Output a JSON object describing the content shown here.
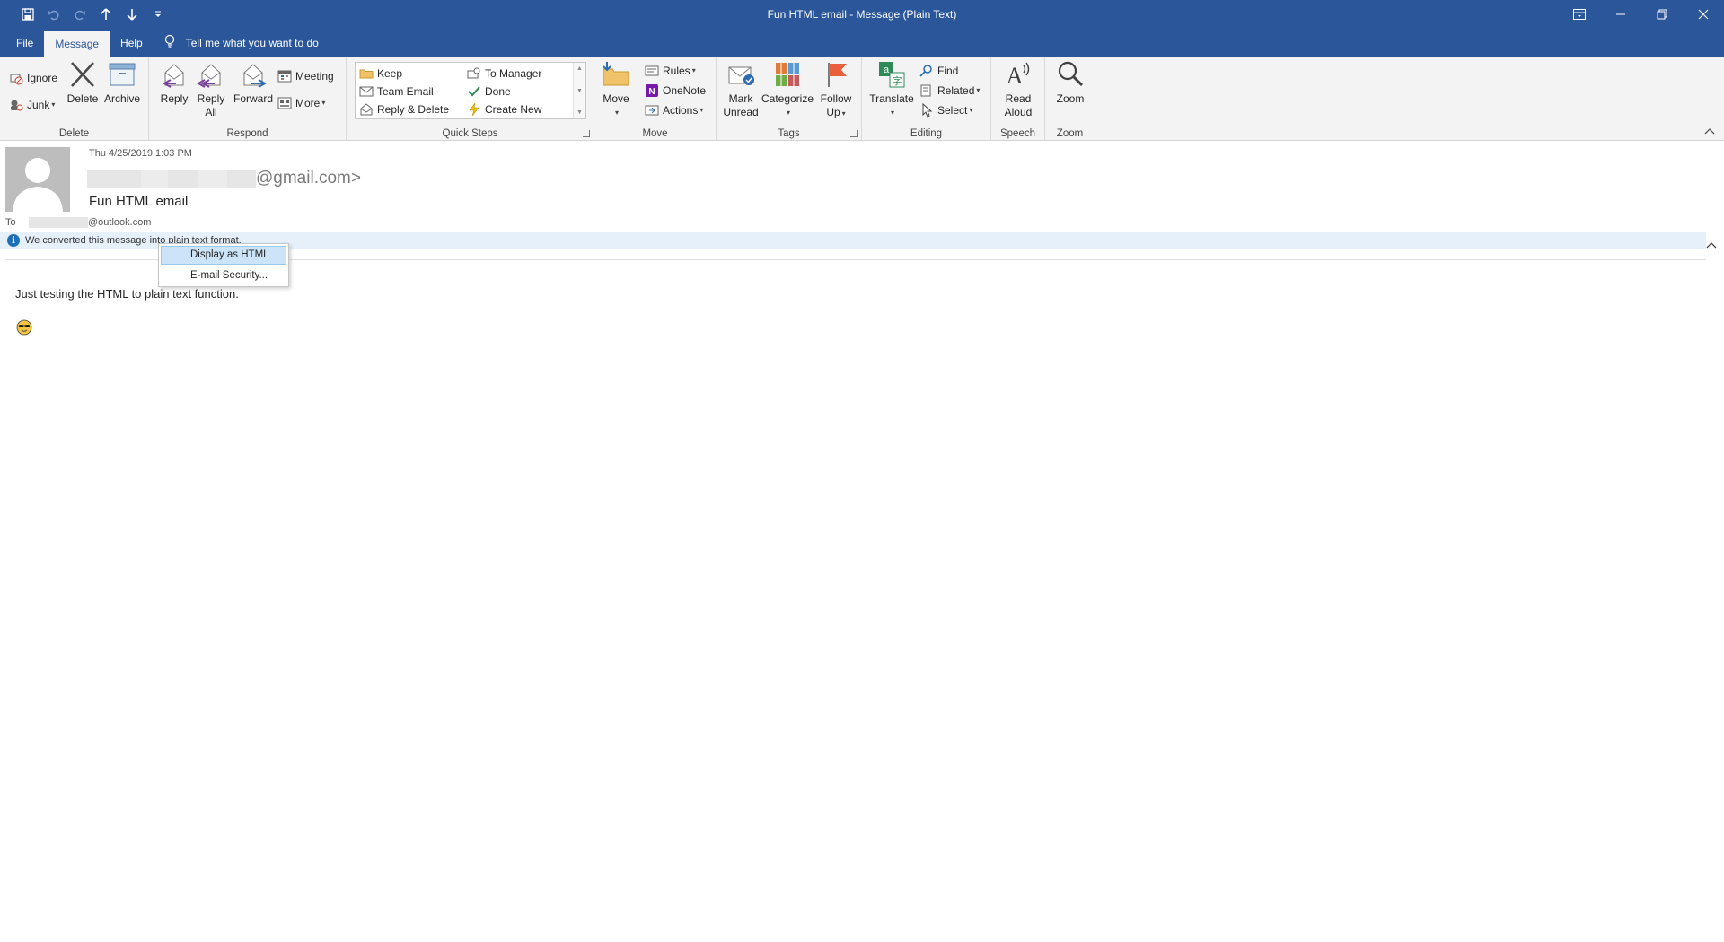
{
  "window": {
    "title": "Fun HTML email  -  Message (Plain Text)"
  },
  "quick_access": {
    "items": [
      "save-icon",
      "undo-icon",
      "redo-icon",
      "previous-item-icon",
      "next-item-icon",
      "customize-icon"
    ]
  },
  "tabs": [
    {
      "label": "File"
    },
    {
      "label": "Message",
      "active": true
    },
    {
      "label": "Help"
    }
  ],
  "tell_me": "Tell me what you want to do",
  "ribbon": {
    "delete_group": {
      "label": "Delete",
      "ignore": "Ignore",
      "junk": "Junk",
      "delete": "Delete",
      "archive": "Archive"
    },
    "respond_group": {
      "label": "Respond",
      "reply": "Reply",
      "reply_all_1": "Reply",
      "reply_all_2": "All",
      "forward": "Forward",
      "meeting": "Meeting",
      "more": "More"
    },
    "quick_steps_group": {
      "label": "Quick Steps",
      "keep": "Keep",
      "team_email": "Team Email",
      "reply_delete": "Reply & Delete",
      "to_manager": "To Manager",
      "done": "Done",
      "create_new": "Create New"
    },
    "move_group": {
      "label": "Move",
      "move": "Move",
      "rules": "Rules",
      "onenote": "OneNote",
      "actions": "Actions"
    },
    "tags_group": {
      "label": "Tags",
      "mark_unread_1": "Mark",
      "mark_unread_2": "Unread",
      "categorize": "Categorize",
      "follow_up_1": "Follow",
      "follow_up_2": "Up"
    },
    "editing_group": {
      "label": "Editing",
      "translate": "Translate",
      "find": "Find",
      "related": "Related",
      "select": "Select"
    },
    "speech_group": {
      "label": "Speech",
      "read_aloud_1": "Read",
      "read_aloud_2": "Aloud"
    },
    "zoom_group": {
      "label": "Zoom",
      "zoom": "Zoom"
    }
  },
  "message": {
    "date": "Thu 4/25/2019 1:03 PM",
    "from_suffix": "@gmail.com>",
    "subject": "Fun HTML email",
    "to_label": "To",
    "to_suffix": "@outlook.com",
    "info_bar": "We converted this message into plain text format.",
    "body": "Just testing the HTML to plain text function."
  },
  "context_menu": {
    "items": [
      "Display as HTML",
      "E-mail Security..."
    ]
  },
  "colors": {
    "title_bar": "#2b579a",
    "ribbon_bg": "#f3f3f3",
    "info_bar_bg": "#e5f0fb",
    "menu_highlight": "#cce4f7"
  }
}
